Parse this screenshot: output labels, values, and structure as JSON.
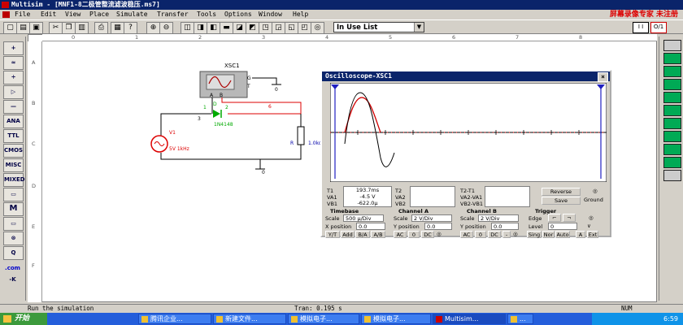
{
  "window": {
    "title": "Multisim - [MNF1-8二极管整流滤波稳压.ms7]",
    "banner": "屏幕录像专家 未注册"
  },
  "menu": [
    "File",
    "Edit",
    "View",
    "Place",
    "Simulate",
    "Transfer",
    "Tools",
    "Options",
    "Window",
    "Help"
  ],
  "toolbar": {
    "in_use_list": "In Use List",
    "right_indicator_1": "I I",
    "right_indicator_2": "O/1"
  },
  "left_palette": [
    "+",
    "≈",
    "÷",
    "▷",
    "—",
    "ANA",
    "TTL",
    "CMOS",
    "MISC",
    "MIXED",
    "▭",
    "M",
    "▭",
    "⊗",
    "Q",
    ".com",
    "-K"
  ],
  "rulers": {
    "columns": [
      "0",
      "1",
      "2",
      "3",
      "4",
      "5",
      "6",
      "7",
      "8"
    ],
    "rows": [
      "A",
      "B",
      "C",
      "D",
      "E",
      "F"
    ]
  },
  "schematic": {
    "scope_ref": "XSC1",
    "scope_terminals": [
      "A",
      "B",
      "G",
      "T"
    ],
    "source_ref": "V1",
    "source_value": "5V 1kHz",
    "diode_ref": "D",
    "diode_part": "1N4148",
    "resistor_ref": "R",
    "resistor_value": "1.0kohm",
    "nodes": [
      "1",
      "2",
      "3",
      "6",
      "0",
      "0"
    ]
  },
  "oscilloscope": {
    "title": "Oscilloscope-XSC1",
    "cursors": {
      "t1_label": "T1",
      "va1_label": "VA1",
      "vb1_label": "VB1",
      "t1_value": "193.7ms",
      "va1_value": "-4.5 V",
      "vb1_value": "-622.0µ",
      "t2_label": "T2",
      "va2_label": "VA2",
      "vb2_label": "VB2",
      "dt_label": "T2-T1",
      "dva_label": "VA2-VA1",
      "dvb_label": "VB2-VB1"
    },
    "buttons": {
      "reverse": "Reverse",
      "save": "Save",
      "ground": "Ground"
    },
    "timebase": {
      "header": "Timebase",
      "scale_label": "Scale",
      "scale_value": "500 µ/Div",
      "xpos_label": "X position",
      "xpos_value": "0.0",
      "modes": [
        "Y/T",
        "Add",
        "B/A",
        "A/B"
      ]
    },
    "channel_a": {
      "header": "Channel A",
      "scale_label": "Scale",
      "scale_value": "2 V/Div",
      "ypos_label": "Y position",
      "ypos_value": "0.0",
      "coupling": [
        "AC",
        "0",
        "DC"
      ]
    },
    "channel_b": {
      "header": "Channel B",
      "scale_label": "Scale",
      "scale_value": "2 V/Div",
      "ypos_label": "Y position",
      "ypos_value": "0.0",
      "coupling": [
        "AC",
        "0",
        "DC",
        "-"
      ]
    },
    "trigger": {
      "header": "Trigger",
      "edge_label": "Edge",
      "level_label": "Level",
      "level_value": "0",
      "modes": [
        "Sing",
        "Nor",
        "Auto",
        "A",
        "Ext"
      ]
    },
    "colors": {
      "channel_a": "#d00000",
      "trace": "#000000",
      "cursor": "#2020c0",
      "axis": "#ff0000"
    }
  },
  "status": {
    "message": "Run the simulation",
    "tran": "Tran: 0.195 s",
    "num": "NUM"
  },
  "taskbar": {
    "start": "开始",
    "tasks": [
      "腾讯企业...",
      "新建文件...",
      "模拟电子...",
      "模拟电子...",
      "Multisim...",
      "..."
    ],
    "time": "6:59"
  }
}
